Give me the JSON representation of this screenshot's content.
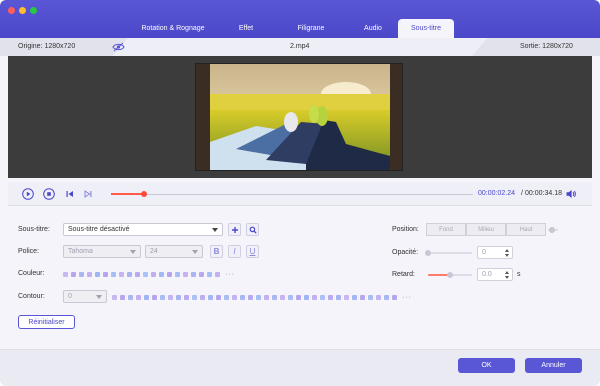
{
  "window": {
    "traffic_lights": [
      "#ff5f57",
      "#febc2e",
      "#28c840"
    ]
  },
  "tabs": [
    {
      "label": "Rotation & Rognage",
      "active": false
    },
    {
      "label": "Effet",
      "active": false
    },
    {
      "label": "Filigrane",
      "active": false
    },
    {
      "label": "Audio",
      "active": false
    },
    {
      "label": "Sous-titre",
      "active": true
    }
  ],
  "info": {
    "origin": "Origine: 1280x720",
    "filename": "2.mp4",
    "output": "Sortie: 1280x720",
    "eye_icon": "eye-icon"
  },
  "player": {
    "current_time": "00:00:02.24",
    "separator": "/",
    "total_time": "00:00:34.18",
    "progress": 0.09,
    "accent": "#ff5a4a"
  },
  "subtitle": {
    "label": "Sous-titre:",
    "value": "Sous-titre désactivé",
    "add_icon": "plus-icon",
    "search_icon": "search-icon"
  },
  "font": {
    "label": "Police:",
    "family": "Tahoma",
    "size": "24",
    "bold": "B",
    "italic": "I",
    "underline": "U"
  },
  "color": {
    "label": "Couleur:",
    "swatches": [
      "#c9b8f0",
      "#b8a6ee",
      "#aab8f2",
      "#c2b0f0",
      "#9fb6f4",
      "#b6a4ee",
      "#a8bdf4",
      "#c6b4f2",
      "#a6b4f2",
      "#baaaf0",
      "#aac0f6",
      "#c0aef0",
      "#a2b8f4",
      "#b4a6ee",
      "#aabcf4",
      "#c4b2f2",
      "#a8b6f2",
      "#b8a8f0",
      "#a6bef6",
      "#c2b0f0"
    ],
    "more": "···"
  },
  "outline": {
    "label": "Contour:",
    "value": "0",
    "swatches": [
      "#c9b8f0",
      "#b8a6ee",
      "#aab8f2",
      "#c2b0f0",
      "#9fb6f4",
      "#b6a4ee",
      "#a8bdf4",
      "#c6b4f2",
      "#a6b4f2",
      "#baaaf0",
      "#aac0f6",
      "#c0aef0",
      "#a2b8f4",
      "#b4a6ee",
      "#aabcf4",
      "#c4b2f2",
      "#a8b6f2",
      "#b8a8f0",
      "#a6bef6",
      "#c2b0f0",
      "#aab8f2",
      "#c6b4f2",
      "#a8bdf4",
      "#b6a4ee",
      "#9fb6f4",
      "#c2b0f0",
      "#aac0f6",
      "#baaaf0",
      "#a6b4f2",
      "#c9b8f0",
      "#a2b8f4",
      "#b8a6ee",
      "#aabcf4",
      "#c4b2f2",
      "#a8b6f2",
      "#b4a6ee"
    ],
    "more": "···"
  },
  "position": {
    "label": "Position:",
    "options": [
      "Fond",
      "Milieu",
      "Haut"
    ]
  },
  "opacity": {
    "label": "Opacité:",
    "value": "0"
  },
  "delay": {
    "label": "Retard:",
    "value": "0.0",
    "unit": "s"
  },
  "reset_label": "Réinitialiser",
  "ok_label": "OK",
  "cancel_label": "Annuler"
}
